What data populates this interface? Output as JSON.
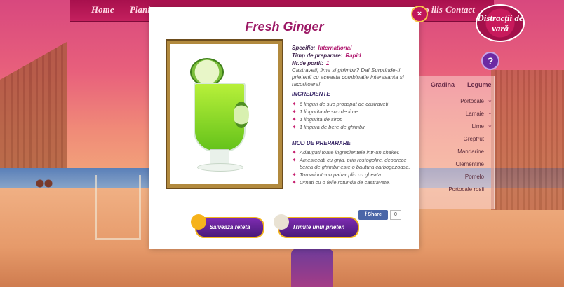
{
  "nav": {
    "items": [
      "Home",
      "Plani vaca",
      "ipo ilis",
      "Contact"
    ]
  },
  "brand": {
    "distractii": "Distracții de vară"
  },
  "help": "?",
  "filters": {
    "headers": [
      "Gradina",
      "Legume"
    ],
    "items": [
      "Portocale",
      "Lamaie",
      "Lime",
      "Grepfrut",
      "Mandarine",
      "Clementine",
      "Pomelo",
      "Portocale rosii"
    ]
  },
  "recipe": {
    "title": "Fresh Ginger",
    "specific_label": "Specific:",
    "specific_value": "International",
    "prep_label": "Timp de preparare:",
    "prep_value": "Rapid",
    "portions_label": "Nr.de portii:",
    "portions_value": "1",
    "description": "Castraveti, lime si ghimbir? Da! Surprinde-ti prietenii cu aceasta combinatie interesanta si racoritoare!",
    "ingredients_title": "INGREDIENTE",
    "ingredients": [
      "6 linguri de suc proaspat de castraveti",
      "1 lingurita de suc de lime",
      "1 lingurita de sirop",
      "1 lingura de bere de ghimbir"
    ],
    "method_title": "MOD DE PREPARARE",
    "method": [
      "Adaugati toate ingredientele intr-un shaker.",
      "Amestecati cu grija, prin rostogolire, deoarece berea de ghimbir este o bautura carbogazoasa.",
      "Turnati intr-un pahar plin cu gheata.",
      "Ornati cu o felie rotunda de castravete."
    ]
  },
  "actions": {
    "share": "Share",
    "share_count": "0",
    "save": "Salveaza reteta",
    "send": "Trimite unui prieten"
  },
  "close": "×",
  "colors": {
    "accent": "#9c1865",
    "button": "#4a1a7a",
    "border": "#f2b41d"
  }
}
